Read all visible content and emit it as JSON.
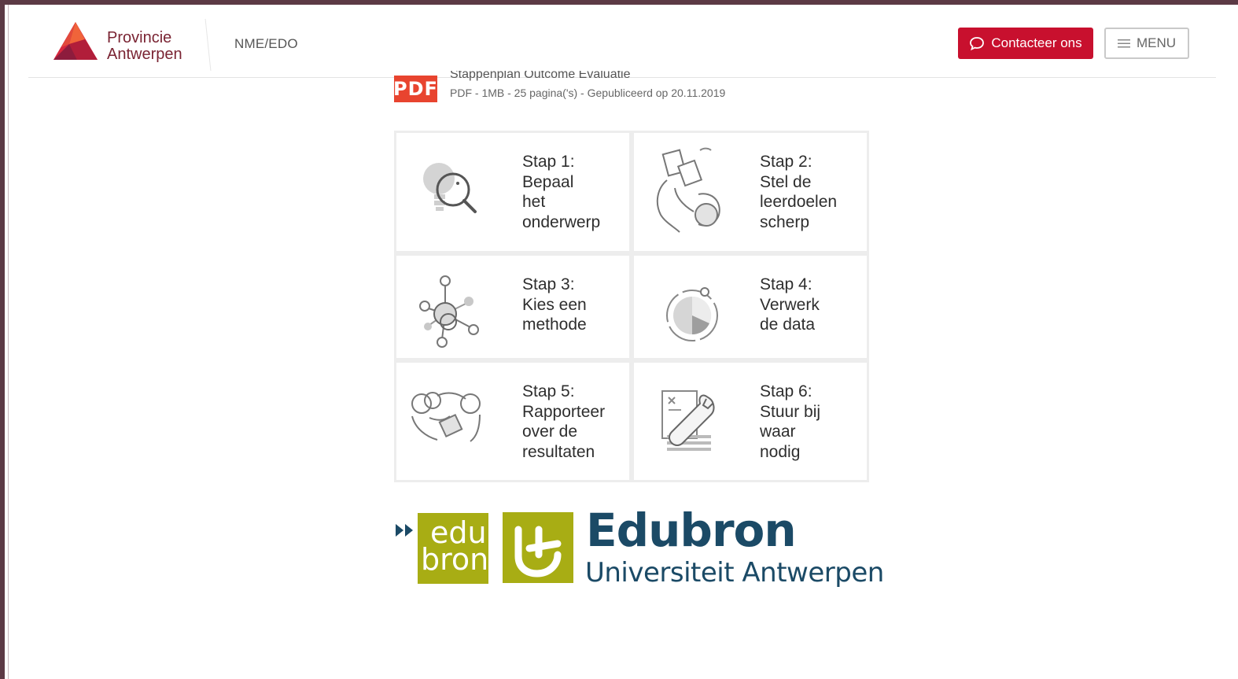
{
  "header": {
    "logo_line1": "Provincie",
    "logo_line2": "Antwerpen",
    "breadcrumb": "NME/EDO",
    "contact_label": "Contacteer ons",
    "menu_label": "MENU"
  },
  "document": {
    "badge": "PDF",
    "title": "Stappenplan Outcome Evaluatie",
    "meta": "PDF - 1MB - 25 pagina('s) - Gepubliceerd op 20.11.2019"
  },
  "steps": [
    {
      "label": "Stap 1:\nBepaal\nhet\nonderwerp",
      "icon": "magnifier-bulb-icon"
    },
    {
      "label": "Stap 2:\nStel de\nleerdoelen\nscherp",
      "icon": "notes-head-icon"
    },
    {
      "label": "Stap 3:\nKies een\nmethode",
      "icon": "network-search-icon"
    },
    {
      "label": "Stap 4:\nVerwerk\nde data",
      "icon": "pie-chart-icon"
    },
    {
      "label": "Stap 5:\nRapporteer\nover de\nresultaten",
      "icon": "people-report-icon"
    },
    {
      "label": "Stap 6:\nStuur bij\nwaar\nnodig",
      "icon": "wrench-document-icon"
    }
  ],
  "footer": {
    "edu_logo_line1": "edu",
    "edu_logo_line2": "bron",
    "org_name": "Edubron",
    "org_sub": "Universiteit Antwerpen"
  },
  "colors": {
    "brand_red": "#c8102e",
    "pdf_red": "#e8442f",
    "edubron_green": "#a8ad14",
    "edubron_blue": "#1b4a66"
  }
}
